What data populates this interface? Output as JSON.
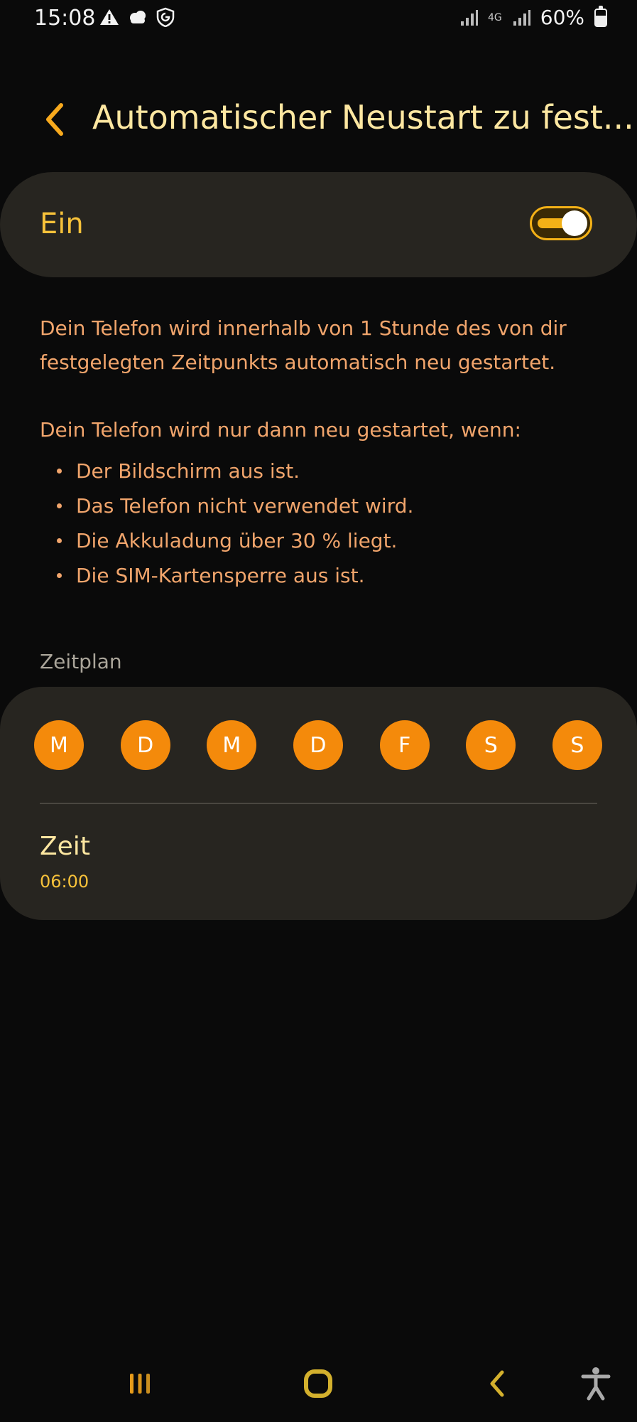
{
  "status_bar": {
    "time": "15:08",
    "network": "4G",
    "battery": "60%",
    "battery_level": 0.6
  },
  "header": {
    "title": "Automatischer Neustart zu fest...",
    "back_icon": "chevron-left-icon"
  },
  "main_toggle": {
    "label": "Ein",
    "state": true
  },
  "description": {
    "paragraph1": "Dein Telefon wird innerhalb von 1 Stunde des von dir festgelegten Zeitpunkts automatisch neu gestartet.",
    "paragraph2": "Dein Telefon wird nur dann neu gestartet, wenn:",
    "conditions": [
      "Der Bildschirm aus ist.",
      "Das Telefon nicht verwendet wird.",
      "Die Akkuladung über 30 % liegt.",
      "Die SIM-Kartensperre aus ist."
    ]
  },
  "schedule": {
    "section_label": "Zeitplan",
    "days": [
      "M",
      "D",
      "M",
      "D",
      "F",
      "S",
      "S"
    ],
    "time_label": "Zeit",
    "time_value": "06:00"
  },
  "colors": {
    "accent": "#f7c23a",
    "day_circle": "#f48a0b",
    "description_text": "#f1a56c",
    "card_bg": "#272520"
  }
}
